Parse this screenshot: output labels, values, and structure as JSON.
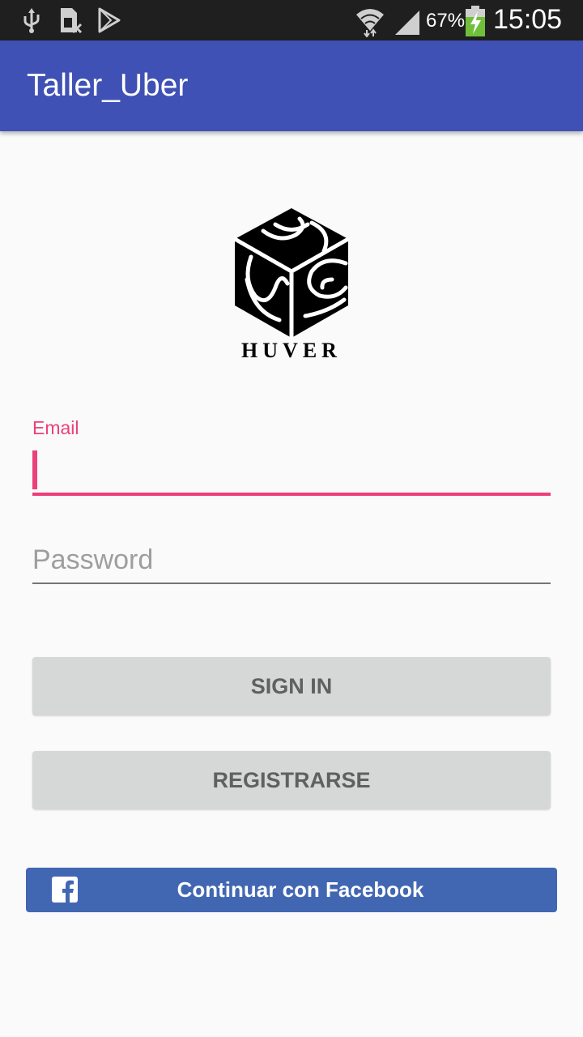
{
  "status_bar": {
    "battery_percent": "67%",
    "time": "15:05",
    "icons": [
      "usb-icon",
      "sim-icon",
      "play-store-icon",
      "wifi-icon",
      "signal-icon",
      "battery-charging-icon"
    ]
  },
  "app_bar": {
    "title": "Taller_Uber"
  },
  "logo": {
    "text": "HUVER"
  },
  "form": {
    "email": {
      "label": "Email",
      "value": ""
    },
    "password": {
      "placeholder": "Password",
      "value": ""
    }
  },
  "buttons": {
    "sign_in": "SIGN IN",
    "register": "REGISTRARSE",
    "facebook": "Continuar con Facebook"
  },
  "colors": {
    "app_bar": "#3f51b5",
    "accent": "#ec407a",
    "facebook": "#4267b2",
    "button_gray": "#d6d7d7"
  }
}
